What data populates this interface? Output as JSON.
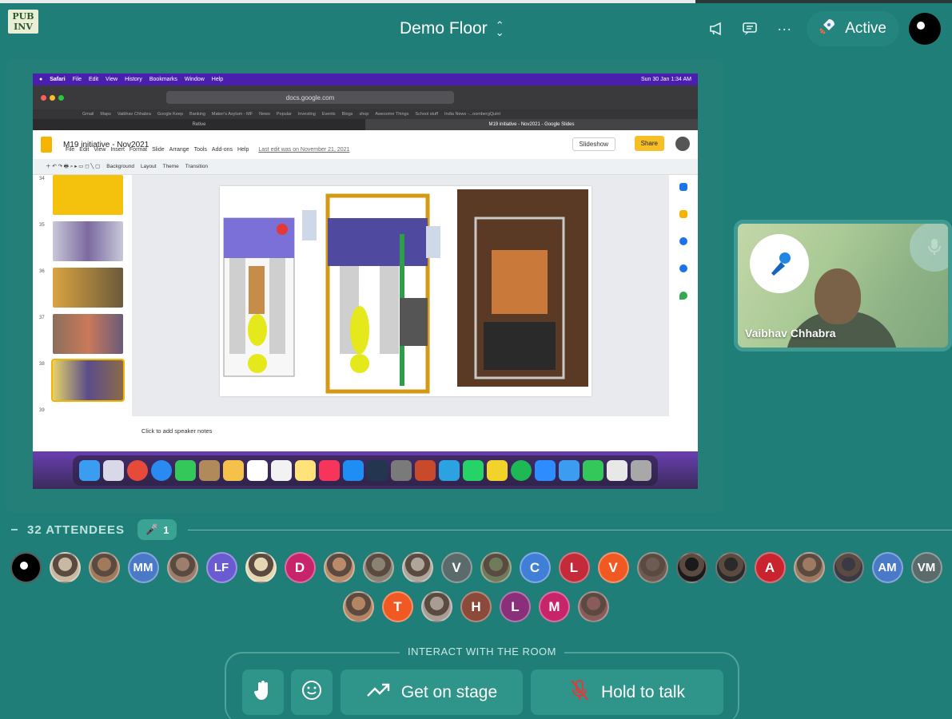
{
  "app": {
    "logo_text": "PUB INV",
    "room_title": "Demo Floor",
    "status_label": "Active"
  },
  "screen_share": {
    "menubar": {
      "items": [
        "Safari",
        "File",
        "Edit",
        "View",
        "History",
        "Bookmarks",
        "Window",
        "Help"
      ],
      "clock": "Sun 30 Jan  1:34 AM"
    },
    "url": "docs.google.com",
    "bookmarks": [
      "Gmail",
      "Maps",
      "Vaibhav Chhabra",
      "Google Keep",
      "Banking",
      "Maker's Asylum - MF",
      "News",
      "Popular",
      "Investing",
      "Events",
      "Blogs",
      "shop",
      "Awesome Things",
      "School stuff",
      "India News -...oombergQuint"
    ],
    "tabs": [
      "Retive",
      "M19 initiative - Nov2021 - Google Slides"
    ],
    "slides": {
      "doc_title": "M19 initiative - Nov2021",
      "menu": [
        "File",
        "Edit",
        "View",
        "Insert",
        "Format",
        "Slide",
        "Arrange",
        "Tools",
        "Add-ons",
        "Help"
      ],
      "last_edit": "Last edit was on November 21, 2021",
      "slideshow_label": "Slideshow",
      "share_label": "Share",
      "toolbar": [
        "Background",
        "Layout",
        "Theme",
        "Transition"
      ],
      "slide_numbers": [
        "34",
        "35",
        "36",
        "37",
        "38",
        "39"
      ],
      "speaker_notes_placeholder": "Click to add speaker notes"
    }
  },
  "video": {
    "participant_name": "Vaibhav Chhabra"
  },
  "attendees": {
    "header_label": "32 ATTENDEES",
    "stage_count": "1",
    "row1": [
      {
        "initials": "",
        "color": "#000000",
        "kind": "black-dot"
      },
      {
        "initials": "",
        "color": "#c9b9a3",
        "kind": "photo"
      },
      {
        "initials": "",
        "color": "#a07a5a",
        "kind": "photo"
      },
      {
        "initials": "MM",
        "color": "#4a79c8"
      },
      {
        "initials": "",
        "color": "#9b7e6c",
        "kind": "photo"
      },
      {
        "initials": "LF",
        "color": "#6a5bd0"
      },
      {
        "initials": "",
        "color": "#e6d7b2",
        "kind": "photo"
      },
      {
        "initials": "D",
        "color": "#c8246b"
      },
      {
        "initials": "",
        "color": "#b98b6a",
        "kind": "photo"
      },
      {
        "initials": "",
        "color": "#8a8273",
        "kind": "photo"
      },
      {
        "initials": "",
        "color": "#b0a59a",
        "kind": "photo"
      },
      {
        "initials": "V",
        "color": "#5b6a6a"
      },
      {
        "initials": "",
        "color": "#6e7c5a",
        "kind": "photo"
      },
      {
        "initials": "C",
        "color": "#3f7fd8"
      },
      {
        "initials": "L",
        "color": "#c42a3a"
      },
      {
        "initials": "V",
        "color": "#f05a22"
      },
      {
        "initials": "",
        "color": "#6d5b54",
        "kind": "photo"
      },
      {
        "initials": "",
        "color": "#1a1a1a",
        "kind": "photo"
      },
      {
        "initials": "",
        "color": "#2a2a2a",
        "kind": "photo"
      },
      {
        "initials": "A",
        "color": "#c8232f"
      },
      {
        "initials": "",
        "color": "#9d7a62",
        "kind": "photo"
      },
      {
        "initials": "",
        "color": "#3a3a44",
        "kind": "photo"
      },
      {
        "initials": "AM",
        "color": "#4a79c8"
      },
      {
        "initials": "VM",
        "color": "#5b6a6a"
      }
    ],
    "row2": [
      {
        "initials": "",
        "color": "#b58463",
        "kind": "photo"
      },
      {
        "initials": "T",
        "color": "#f05a22"
      },
      {
        "initials": "",
        "color": "#a79d95",
        "kind": "photo"
      },
      {
        "initials": "H",
        "color": "#8b4a3a"
      },
      {
        "initials": "L",
        "color": "#8a2f7a"
      },
      {
        "initials": "M",
        "color": "#c8246b"
      },
      {
        "initials": "",
        "color": "#8a5b5b",
        "kind": "photo"
      }
    ]
  },
  "interact": {
    "label": "INTERACT WITH THE ROOM",
    "get_on_stage": "Get on stage",
    "hold_to_talk": "Hold to talk"
  }
}
